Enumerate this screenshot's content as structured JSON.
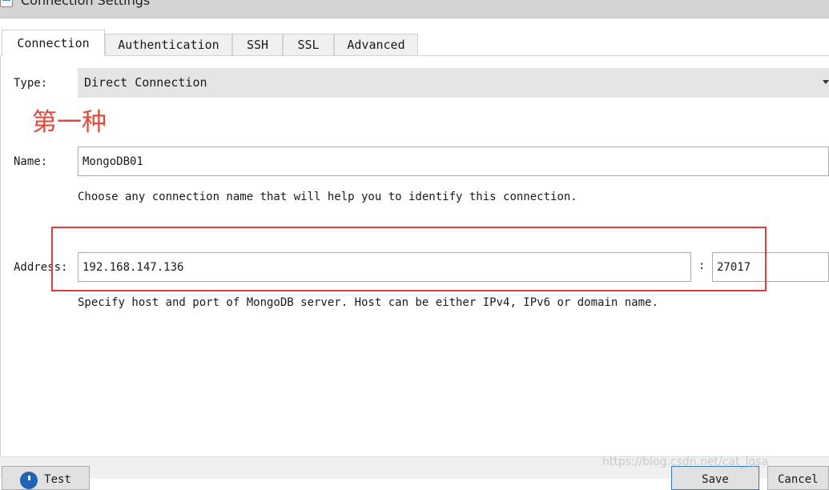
{
  "window": {
    "title": "Connection Settings",
    "icon": "window-icon"
  },
  "tabs": [
    {
      "label": "Connection",
      "active": true
    },
    {
      "label": "Authentication",
      "active": false
    },
    {
      "label": "SSH",
      "active": false
    },
    {
      "label": "SSL",
      "active": false
    },
    {
      "label": "Advanced",
      "active": false
    }
  ],
  "connection": {
    "type_label": "Type:",
    "type_value": "Direct Connection",
    "annotation": "第一种",
    "name_label": "Name:",
    "name_value": "MongoDB01",
    "name_hint": "Choose any connection name that will help you to identify this connection.",
    "address_label": "Address:",
    "host_value": "192.168.147.136",
    "port_separator": ":",
    "port_value": "27017",
    "address_hint": "Specify host and port of MongoDB server. Host can be either IPv4, IPv6 or domain name."
  },
  "buttons": {
    "test_label": "Test",
    "save_label": "Save",
    "cancel_label": "Cancel"
  },
  "watermark": "https://blog.csdn.net/cat_lgsa",
  "colors": {
    "annotation": "#e04a3c",
    "highlight_box": "#e33b3b",
    "default_button_border": "#2a7ad2"
  }
}
